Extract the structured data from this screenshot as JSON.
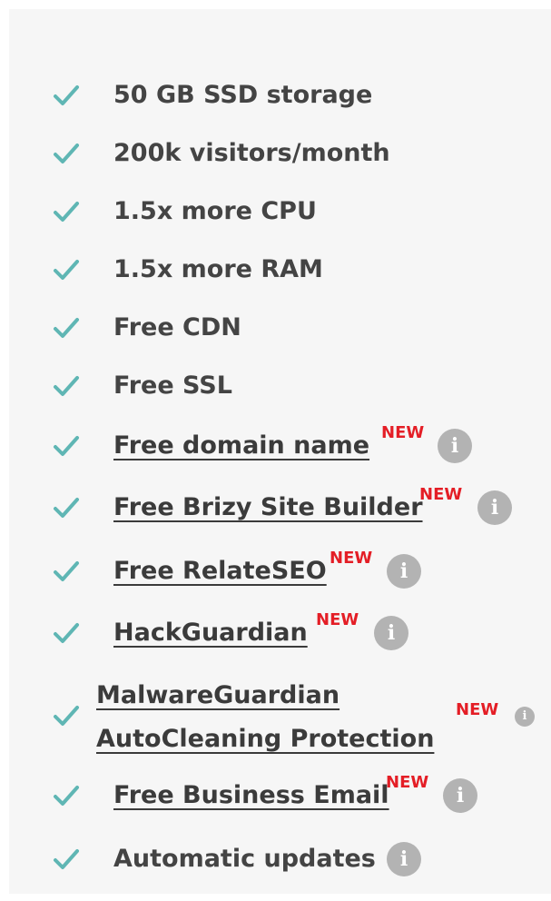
{
  "colors": {
    "panel_background": "#f6f6f6",
    "check": "#5fb6b4",
    "text": "#444444",
    "new_badge": "#e41e26",
    "info_icon": "#b3b3b3"
  },
  "info_icon_glyph": "i",
  "features": [
    {
      "label": "50 GB SSD storage",
      "icon": "check-icon",
      "link": false
    },
    {
      "label": "200k visitors/month",
      "icon": "check-icon",
      "link": false
    },
    {
      "label": "1.5x more CPU",
      "icon": "check-icon",
      "link": false
    },
    {
      "label": "1.5x more RAM",
      "icon": "check-icon",
      "link": false
    },
    {
      "label": "Free CDN",
      "icon": "check-icon",
      "link": false
    },
    {
      "label": "Free SSL",
      "icon": "check-icon",
      "link": false
    },
    {
      "label": "Free domain name",
      "badge": "NEW",
      "info": "info-icon",
      "icon": "check-icon",
      "link": true
    },
    {
      "label": "Free Brizy Site Builder",
      "badge": "NEW",
      "info": "info-icon",
      "icon": "check-icon",
      "link": true
    },
    {
      "label": "Free RelateSEO",
      "badge": "NEW",
      "info": "info-icon",
      "icon": "check-icon",
      "link": true
    },
    {
      "label": "HackGuardian",
      "badge": "NEW",
      "info": "info-icon",
      "icon": "check-icon",
      "link": true
    },
    {
      "label_line1": "MalwareGuardian",
      "label_line2": "AutoCleaning Protection",
      "badge": "NEW",
      "info": "info-icon",
      "icon": "check-icon",
      "link": true
    },
    {
      "label": "Free Business Email",
      "badge": "NEW",
      "info": "info-icon",
      "icon": "check-icon",
      "link": true
    },
    {
      "label": "Automatic updates",
      "info": "info-icon",
      "icon": "check-icon",
      "link": false
    }
  ]
}
